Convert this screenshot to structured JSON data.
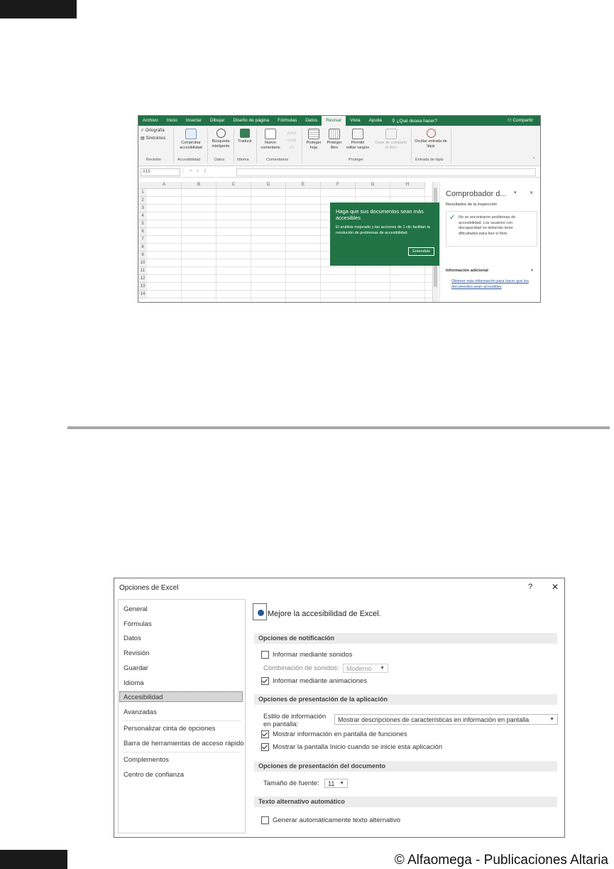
{
  "excel": {
    "tabs": [
      "Archivo",
      "Inicio",
      "Insertar",
      "Dibujar",
      "Diseño de página",
      "Fórmulas",
      "Datos",
      "Revisar",
      "Vista",
      "Ayuda"
    ],
    "active_tab": "Revisar",
    "search": "¿Qué desea hacer?",
    "share": "Compartir",
    "ribbon": {
      "ortografia": "Ortografía",
      "sinonimos": "Sinónimos",
      "comprobar": "Comprobar accesibilidad",
      "busqueda": "Búsqueda inteligente",
      "traducir": "Traducir",
      "nuevo_comentario": "Nuevo comentario",
      "proteger_hoja": "Proteger hoja",
      "proteger_libro": "Proteger libro",
      "permitir": "Permitir editar rangos",
      "dejar_compartir": "Dejar de compartir el libro",
      "ocultar": "Ocultar entrada de lápiz",
      "groups": {
        "revision": "Revisión",
        "accesibilidad": "Accesibilidad",
        "datos": "Datos",
        "idioma": "Idioma",
        "comentarios": "Comentarios",
        "proteger": "Proteger",
        "entrada": "Entrada de lápiz"
      }
    },
    "name_box": "A16",
    "columns": [
      "A",
      "B",
      "C",
      "D",
      "E",
      "F",
      "G",
      "H"
    ],
    "rows": [
      "1",
      "2",
      "3",
      "4",
      "5",
      "6",
      "7",
      "8",
      "9",
      "10",
      "11",
      "12",
      "13",
      "14"
    ],
    "tooltip": {
      "title": "Haga que sus documentos sean más accesibles",
      "body": "El análisis mejorado y las acciones de 1 clic facilitan la resolución de problemas de accesibilidad.",
      "button": "Entendido"
    },
    "pane": {
      "title": "Comprobador d...",
      "pin": "▾",
      "close": "×",
      "subtitle": "Resultados de la inspección",
      "result": "No se encontraron problemas de accesibilidad. Los usuarios con discapacidad no deberían tener dificultades para leer el libro.",
      "info_title": "Información adicional",
      "link": "Obtener más información para hacer que los documentos sean accesibles"
    }
  },
  "dialog": {
    "title": "Opciones de Excel",
    "help": "?",
    "close": "✕",
    "nav": [
      "General",
      "Fórmulas",
      "Datos",
      "Revisión",
      "Guardar",
      "Idioma",
      "Accesibilidad",
      "Avanzadas",
      "Personalizar cinta de opciones",
      "Barra de herramientas de acceso rápido",
      "Complementos",
      "Centro de confianza"
    ],
    "selected_nav": "Accesibilidad",
    "heading": "Mejore la accesibilidad de Excel.",
    "sections": {
      "notif": "Opciones de notificación",
      "app": "Opciones de presentación de la aplicación",
      "doc": "Opciones de presentación del documento",
      "alt": "Texto alternativo automático"
    },
    "options": {
      "sonidos": "Informar mediante sonidos",
      "combinacion_label": "Combinación de sonidos:",
      "combinacion_value": "Moderno",
      "animaciones": "Informar mediante animaciones",
      "estilo_label_1": "Estilo de información",
      "estilo_label_2": "en pantalla:",
      "estilo_value": "Mostrar descripciones de características en información en pantalla",
      "funciones": "Mostrar información en pantalla de funciones",
      "inicio": "Mostrar la pantalla Inicio cuando se inicie esta aplicación",
      "tamano_label": "Tamaño de fuente:",
      "tamano_value": "11",
      "generar": "Generar automáticamente texto alternativo"
    }
  },
  "footer": "© Alfaomega - Publicaciones Altaria"
}
